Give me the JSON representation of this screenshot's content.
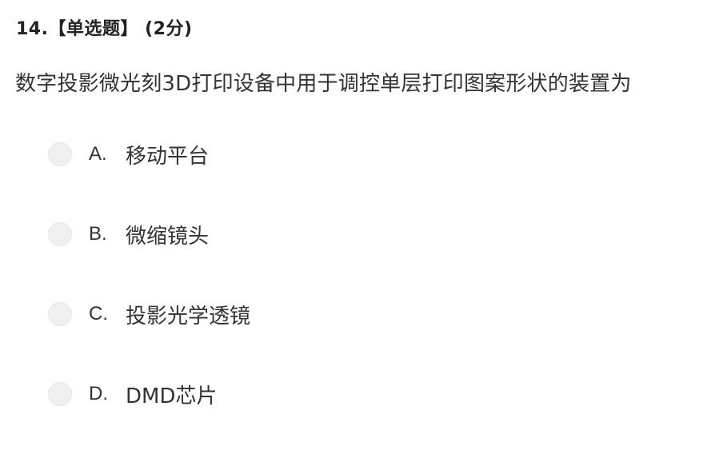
{
  "question": {
    "header": "14.【单选题】 (2分)",
    "stem": "数字投影微光刻3D打印设备中用于调控单层打印图案形状的装置为"
  },
  "options": [
    {
      "letter": "A.",
      "text": "移动平台"
    },
    {
      "letter": "B.",
      "text": "微缩镜头"
    },
    {
      "letter": "C.",
      "text": "投影光学透镜"
    },
    {
      "letter": "D.",
      "text": "DMD芯片"
    }
  ]
}
